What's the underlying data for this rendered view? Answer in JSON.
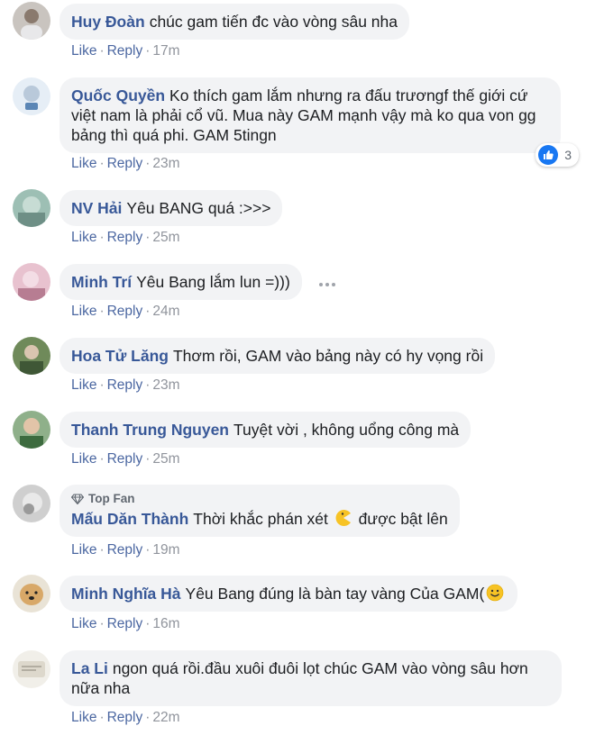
{
  "comments": [
    {
      "name": "Huy Đoàn",
      "text": "chúc gam tiến đc vào vòng sâu nha",
      "like": "Like",
      "reply": "Reply",
      "time": "17m"
    },
    {
      "name": "Quốc Quyền",
      "text_line1": "Ko thích gam lắm nhưng ra đấu trươngf thế giới cứ",
      "text_line2": "việt nam là phải cổ vũ. Mua này GAM mạnh vậy mà ko qua von gg",
      "text_line3": "bảng thì quá phi. GAM 5tingn",
      "like": "Like",
      "reply": "Reply",
      "time": "23m",
      "reaction_count": "3"
    },
    {
      "name": "NV Hải",
      "text": "Yêu BANG quá :>>>",
      "like": "Like",
      "reply": "Reply",
      "time": "25m"
    },
    {
      "name": "Minh Trí",
      "text": "Yêu Bang lắm lun =)))",
      "like": "Like",
      "reply": "Reply",
      "time": "24m"
    },
    {
      "name": "Hoa Tử Lăng",
      "text": "Thơm rồi, GAM vào bảng này có hy vọng rồi",
      "like": "Like",
      "reply": "Reply",
      "time": "23m"
    },
    {
      "name": "Thanh Trung Nguyen",
      "text": "Tuyệt vời , không uổng công mà",
      "like": "Like",
      "reply": "Reply",
      "time": "25m"
    },
    {
      "badge": "Top Fan",
      "name": "Mấu Dăn Thành",
      "text_before": "Thời khắc phán xét",
      "text_after": "được bật lên",
      "like": "Like",
      "reply": "Reply",
      "time": "19m"
    },
    {
      "name": "Minh Nghĩa Hà",
      "text": "Yêu Bang đúng là bàn tay vàng Của GAM(",
      "like": "Like",
      "reply": "Reply",
      "time": "16m"
    },
    {
      "name": "La Li",
      "text_line1": "ngon quá rồi.đầu xuôi đuôi lọt chúc GAM vào vòng sâu hơn",
      "text_line2": "nữa nha",
      "like": "Like",
      "reply": "Reply",
      "time": "22m"
    }
  ],
  "colors": {
    "name": "#385898",
    "bubble": "#f2f3f5",
    "meta_link": "#4b67a1",
    "meta_gray": "#90949c",
    "like_blue": "#1877f2"
  }
}
